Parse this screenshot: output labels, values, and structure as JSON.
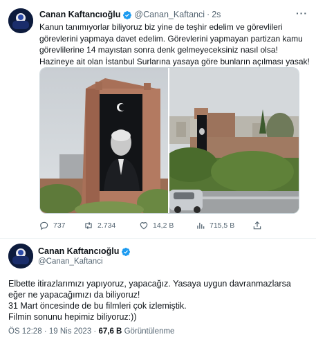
{
  "tweet1": {
    "author_name": "Canan Kaftancıoğlu",
    "handle": "@Canan_Kaftanci",
    "separator": "·",
    "time": "2s",
    "more_label": "···",
    "text_lines": [
      "Kanun tanımıyorlar biliyoruz biz yine de teşhir edelim ve görevlileri",
      "görevlerini yapmaya davet edelim. Görevlerini yapmayan partizan kamu",
      "görevlilerine 14 mayıstan sonra denk gelmeyeceksiniz nasıl olsa!",
      "Hazineye ait olan İstanbul Surlarına yasaya göre bunların açılması yasak!"
    ],
    "actions": {
      "replies": "737",
      "retweets": "2.734",
      "likes": "14,2 B",
      "views": "715,5 B"
    }
  },
  "tweet2": {
    "author_name": "Canan Kaftancıoğlu",
    "handle": "@Canan_Kaftanci",
    "text_lines": [
      "Elbette itirazlarımızı yapıyoruz, yapacağız. Yasaya uygun davranmazlarsa",
      "eğer ne yapacağımızı da biliyoruz!",
      "31 Mart öncesinde de bu filmleri çok izlemiştik.",
      "Filmin sonunu hepimiz biliyoruz:))"
    ],
    "time": "ÖS 12:28",
    "dot": "·",
    "date": "19 Nis 2023",
    "views_count": "67,6 B",
    "views_label": "Görüntülenme"
  },
  "colors": {
    "verified_blue": "#1d9bf0",
    "secondary_text": "#536471",
    "primary_text": "#0f1419"
  }
}
